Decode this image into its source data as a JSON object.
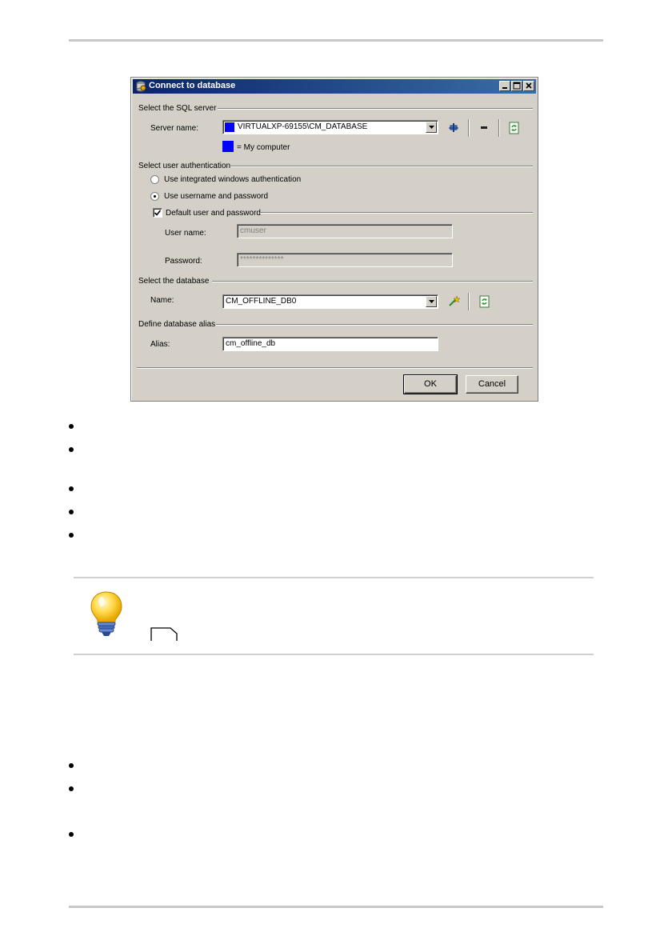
{
  "dialog": {
    "title": "Connect to database",
    "window_controls": {
      "minimize": "minimize",
      "maximize": "maximize",
      "close": "close"
    },
    "sql_server_section": {
      "heading": "Select the SQL server",
      "server_label": "Server name:",
      "server_value": "VIRTUALXP-69155\\CM_DATABASE",
      "legend_text": "= My computer",
      "my_computer_color": "#0000ff"
    },
    "auth_section": {
      "heading": "Select user authentication",
      "option_windows": "Use integrated windows authentication",
      "option_password": "Use username and password",
      "selected": "password",
      "default_user_label": "Default user and password",
      "default_user_checked": true,
      "username_label": "User name:",
      "username_value": "cmuser",
      "password_label": "Password:",
      "password_value": "**************"
    },
    "database_section": {
      "heading": "Select the database",
      "name_label": "Name:",
      "name_value": "CM_OFFLINE_DB0"
    },
    "alias_section": {
      "heading": "Define database alias",
      "alias_label": "Alias:",
      "alias_value": "cm_offline_db"
    },
    "buttons": {
      "ok": "OK",
      "cancel": "Cancel"
    }
  },
  "icons": {
    "add_server": "add-server-icon",
    "remove_server": "remove-server-icon",
    "refresh": "refresh-icon",
    "new_database": "new-database-icon",
    "tip": "lightbulb-icon",
    "page_ref": "page-reference-icon"
  },
  "colors": {
    "titlebar_start": "#0a246a",
    "titlebar_end": "#3a6ea5",
    "dialog_face": "#d4d0c8"
  }
}
